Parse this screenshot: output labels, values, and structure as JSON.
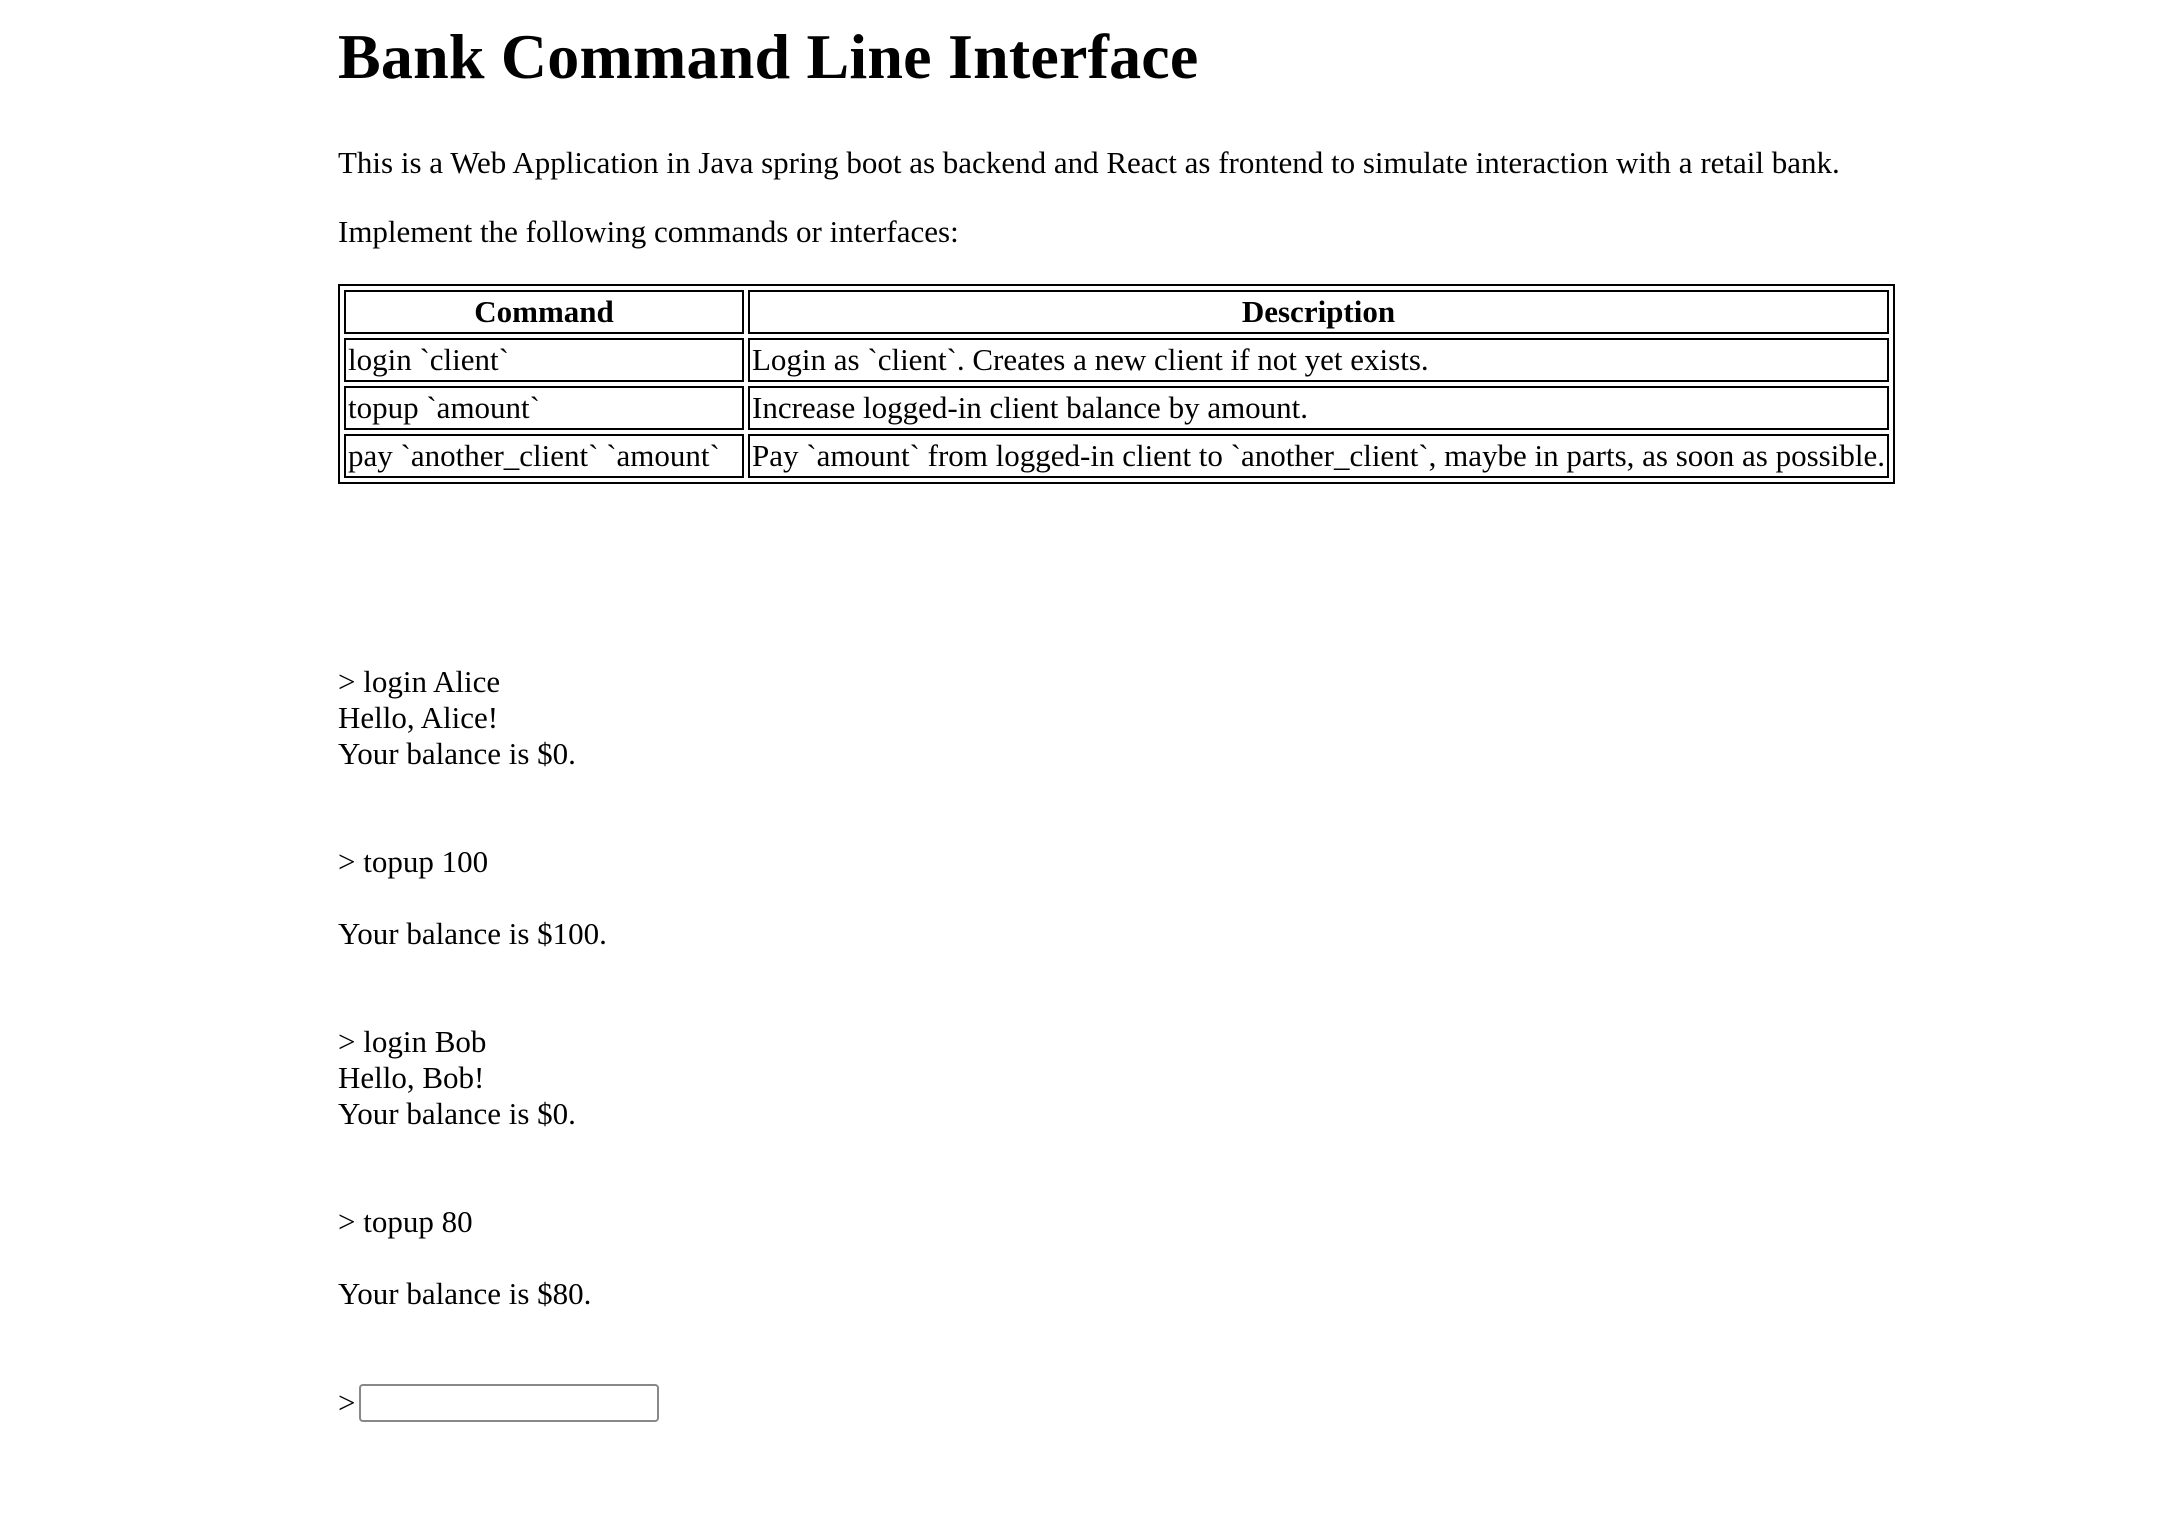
{
  "page": {
    "title": "Bank Command Line Interface",
    "intro": "This is a Web Application in Java spring boot as backend and React as frontend to simulate interaction with a retail bank.",
    "instructions": "Implement the following commands or interfaces:"
  },
  "table": {
    "headers": [
      "Command",
      "Description"
    ],
    "rows": [
      [
        "login `client`",
        "Login as `client`. Creates a new client if not yet exists."
      ],
      [
        "topup `amount`",
        "Increase logged-in client balance by amount."
      ],
      [
        "pay `another_client` `amount`",
        "Pay `amount` from logged-in client to `another_client`, maybe in parts, as soon as possible."
      ]
    ]
  },
  "console": {
    "prompt_symbol": ">",
    "entries": [
      {
        "command": "> login Alice",
        "output": [
          "Hello, Alice!",
          "Your balance is $0."
        ]
      },
      {
        "command": "> topup 100",
        "output": [
          "",
          "Your balance is $100."
        ]
      },
      {
        "command": "> login Bob",
        "output": [
          "Hello, Bob!",
          "Your balance is $0."
        ]
      },
      {
        "command": "> topup 80",
        "output": [
          "",
          "Your balance is $80."
        ]
      }
    ],
    "input_value": "",
    "input_placeholder": ""
  }
}
